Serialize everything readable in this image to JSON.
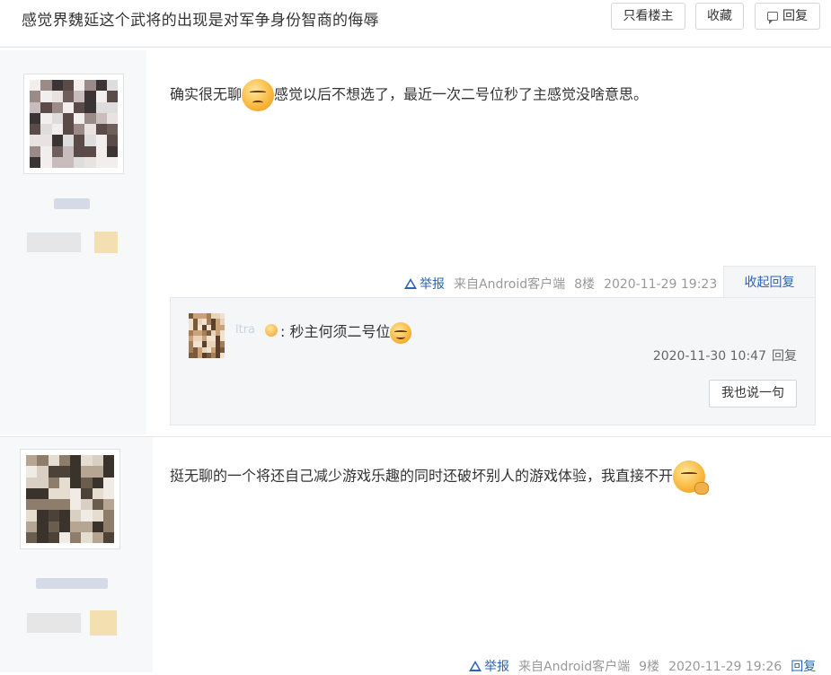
{
  "header": {
    "title": "感觉界魏延这个武将的出现是对军争身份智商的侮辱",
    "only_op_label": "只看楼主",
    "favorite_label": "收藏",
    "reply_label": "回复",
    "reply_icon": "comment-icon"
  },
  "posts": [
    {
      "content_before": "确实很无聊",
      "emoji": "frown-emoji",
      "content_after": "感觉以后不想选了，最近一次二号位秒了主感觉没啥意思。",
      "report": "举报",
      "client": "来自Android客户端",
      "floor": "8楼",
      "time": "2020-11-29 19:23",
      "collapse_label": "收起回复",
      "replies": [
        {
          "user_partial": "ltra",
          "text": ": 秒主何须二号位",
          "emoji": "grin-emoji",
          "time": "2020-11-30 10:47",
          "reply_label": "回复"
        }
      ],
      "say_label": "我也说一句"
    },
    {
      "content": "挺无聊的一个将还自己减少游戏乐趣的同时还破坏别人的游戏体验，我直接不开",
      "emoji": "shush-emoji",
      "report": "举报",
      "client": "来自Android客户端",
      "floor": "9楼",
      "time": "2020-11-29 19:26",
      "reply_label": "回复"
    }
  ],
  "colors": {
    "link": "#2d64b3",
    "sidebar": "#f7f8fa",
    "reply_bg": "#f5f6f8"
  }
}
